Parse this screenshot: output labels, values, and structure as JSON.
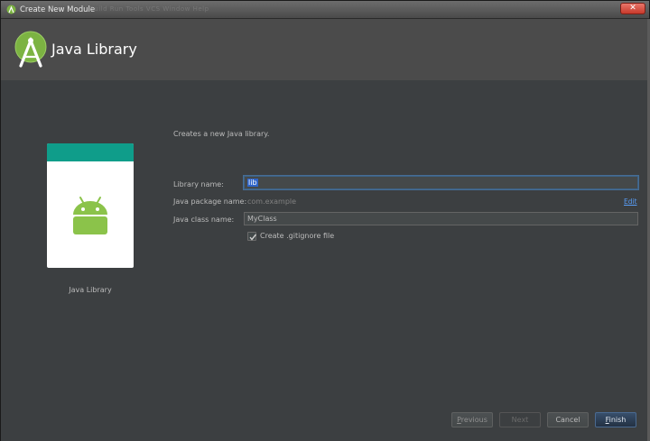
{
  "window": {
    "title": "Create New Module",
    "close_label": "✕",
    "ghost_menu": "Build  Run  Tools  VCS  Window  Help"
  },
  "header": {
    "title": "Java Library"
  },
  "preview": {
    "label": "Java Library"
  },
  "form": {
    "description": "Creates a new Java library.",
    "library_name_label": "Library name:",
    "library_name_value": "lib",
    "package_label": "Java package name:",
    "package_value": "com.example",
    "edit_link": "Edit",
    "class_label": "Java class name:",
    "class_value": "MyClass",
    "gitignore_label": "Create .gitignore file",
    "gitignore_checked": true
  },
  "buttons": {
    "previous_first": "P",
    "previous_rest": "revious",
    "next": "Next",
    "cancel": "Cancel",
    "finish_first": "F",
    "finish_rest": "inish"
  },
  "colors": {
    "accent_teal": "#0f9d8a",
    "android_green": "#8bc34a",
    "link_blue": "#589df6",
    "selection_blue": "#2f65ca"
  },
  "icons": {
    "app": "android-studio-icon",
    "logo": "android-studio-logo",
    "preview": "android-robot-icon",
    "checkbox": "checkmark-icon"
  }
}
